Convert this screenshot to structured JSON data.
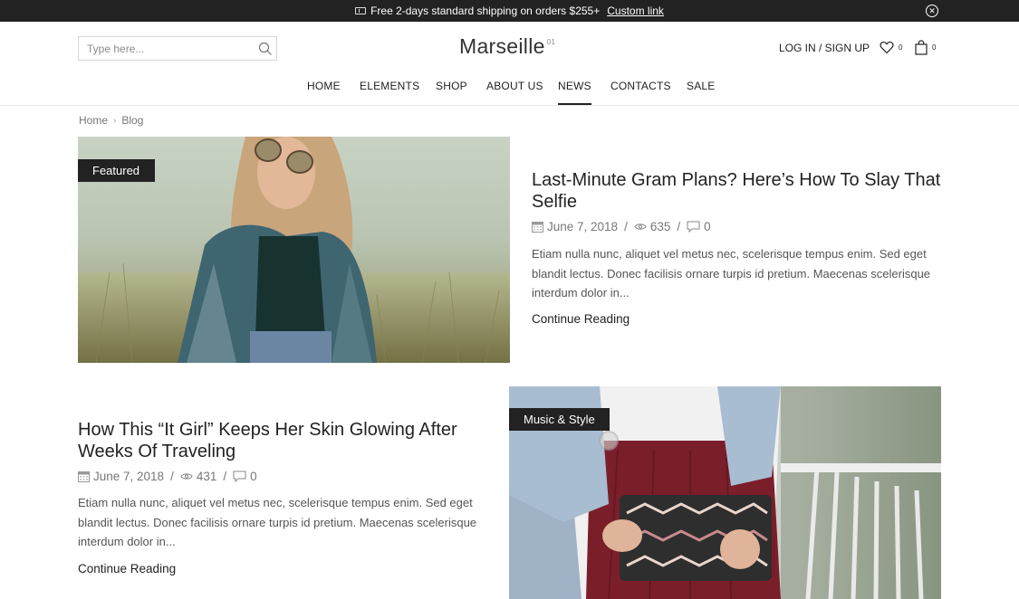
{
  "announcement": {
    "text": "Free 2-days standard shipping on orders $255+",
    "link": "Custom link"
  },
  "search": {
    "placeholder": "Type here..."
  },
  "logo": {
    "name": "Marseille",
    "sup": "01"
  },
  "account": {
    "label": "LOG IN / SIGN UP"
  },
  "wishlist": {
    "count": "0"
  },
  "cart": {
    "count": "0"
  },
  "nav": {
    "items": [
      "HOME",
      "ELEMENTS",
      "SHOP",
      "ABOUT US",
      "NEWS",
      "CONTACTS",
      "SALE"
    ],
    "active": "NEWS"
  },
  "breadcrumb": {
    "home": "Home",
    "current": "Blog"
  },
  "posts": [
    {
      "category": "Featured",
      "title": "Last-Minute Gram Plans? Here’s How To Slay That Selfie",
      "date": "June 7, 2018",
      "views": "635",
      "comments": "0",
      "excerpt": "Etiam nulla nunc, aliquet vel metus nec, scelerisque tempus enim. Sed eget blandit lectus. Donec facilisis ornare turpis id pretium. Maecenas scelerisque interdum dolor in...",
      "read_more": "Continue Reading"
    },
    {
      "category": "Music & Style",
      "title": "How This “It Girl” Keeps Her Skin Glowing After Weeks Of Traveling",
      "date": "June 7, 2018",
      "views": "431",
      "comments": "0",
      "excerpt": "Etiam nulla nunc, aliquet vel metus nec, scelerisque tempus enim. Sed eget blandit lectus. Donec facilisis ornare turpis id pretium. Maecenas scelerisque interdum dolor in...",
      "read_more": "Continue Reading"
    }
  ]
}
